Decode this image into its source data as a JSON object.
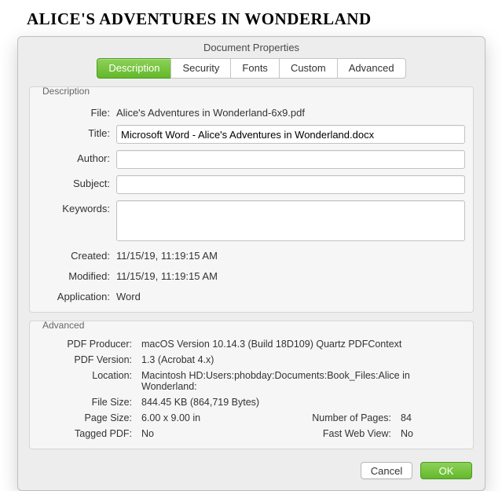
{
  "page": {
    "header": "ALICE'S ADVENTURES IN WONDERLAND"
  },
  "dialog": {
    "title": "Document Properties"
  },
  "tabs": {
    "description": "Description",
    "security": "Security",
    "fonts": "Fonts",
    "custom": "Custom",
    "advanced": "Advanced"
  },
  "desc_group": {
    "legend": "Description",
    "file_label": "File:",
    "file_value": "Alice's Adventures in Wonderland-6x9.pdf",
    "title_label": "Title:",
    "title_value": "Microsoft Word - Alice's Adventures in Wonderland.docx",
    "author_label": "Author:",
    "author_value": "",
    "subject_label": "Subject:",
    "subject_value": "",
    "keywords_label": "Keywords:",
    "keywords_value": "",
    "created_label": "Created:",
    "created_value": "11/15/19, 11:19:15 AM",
    "modified_label": "Modified:",
    "modified_value": "11/15/19, 11:19:15 AM",
    "application_label": "Application:",
    "application_value": "Word"
  },
  "adv_group": {
    "legend": "Advanced",
    "producer_label": "PDF Producer:",
    "producer_value": "macOS Version 10.14.3 (Build 18D109) Quartz PDFContext",
    "version_label": "PDF Version:",
    "version_value": "1.3 (Acrobat 4.x)",
    "location_label": "Location:",
    "location_value": "Macintosh HD:Users:phobday:Documents:Book_Files:Alice in Wonderland:",
    "filesize_label": "File Size:",
    "filesize_value": "844.45 KB (864,719 Bytes)",
    "pagesize_label": "Page Size:",
    "pagesize_value": "6.00 x 9.00 in",
    "numpages_label": "Number of Pages:",
    "numpages_value": "84",
    "tagged_label": "Tagged PDF:",
    "tagged_value": "No",
    "fastweb_label": "Fast Web View:",
    "fastweb_value": "No"
  },
  "buttons": {
    "cancel": "Cancel",
    "ok": "OK"
  }
}
